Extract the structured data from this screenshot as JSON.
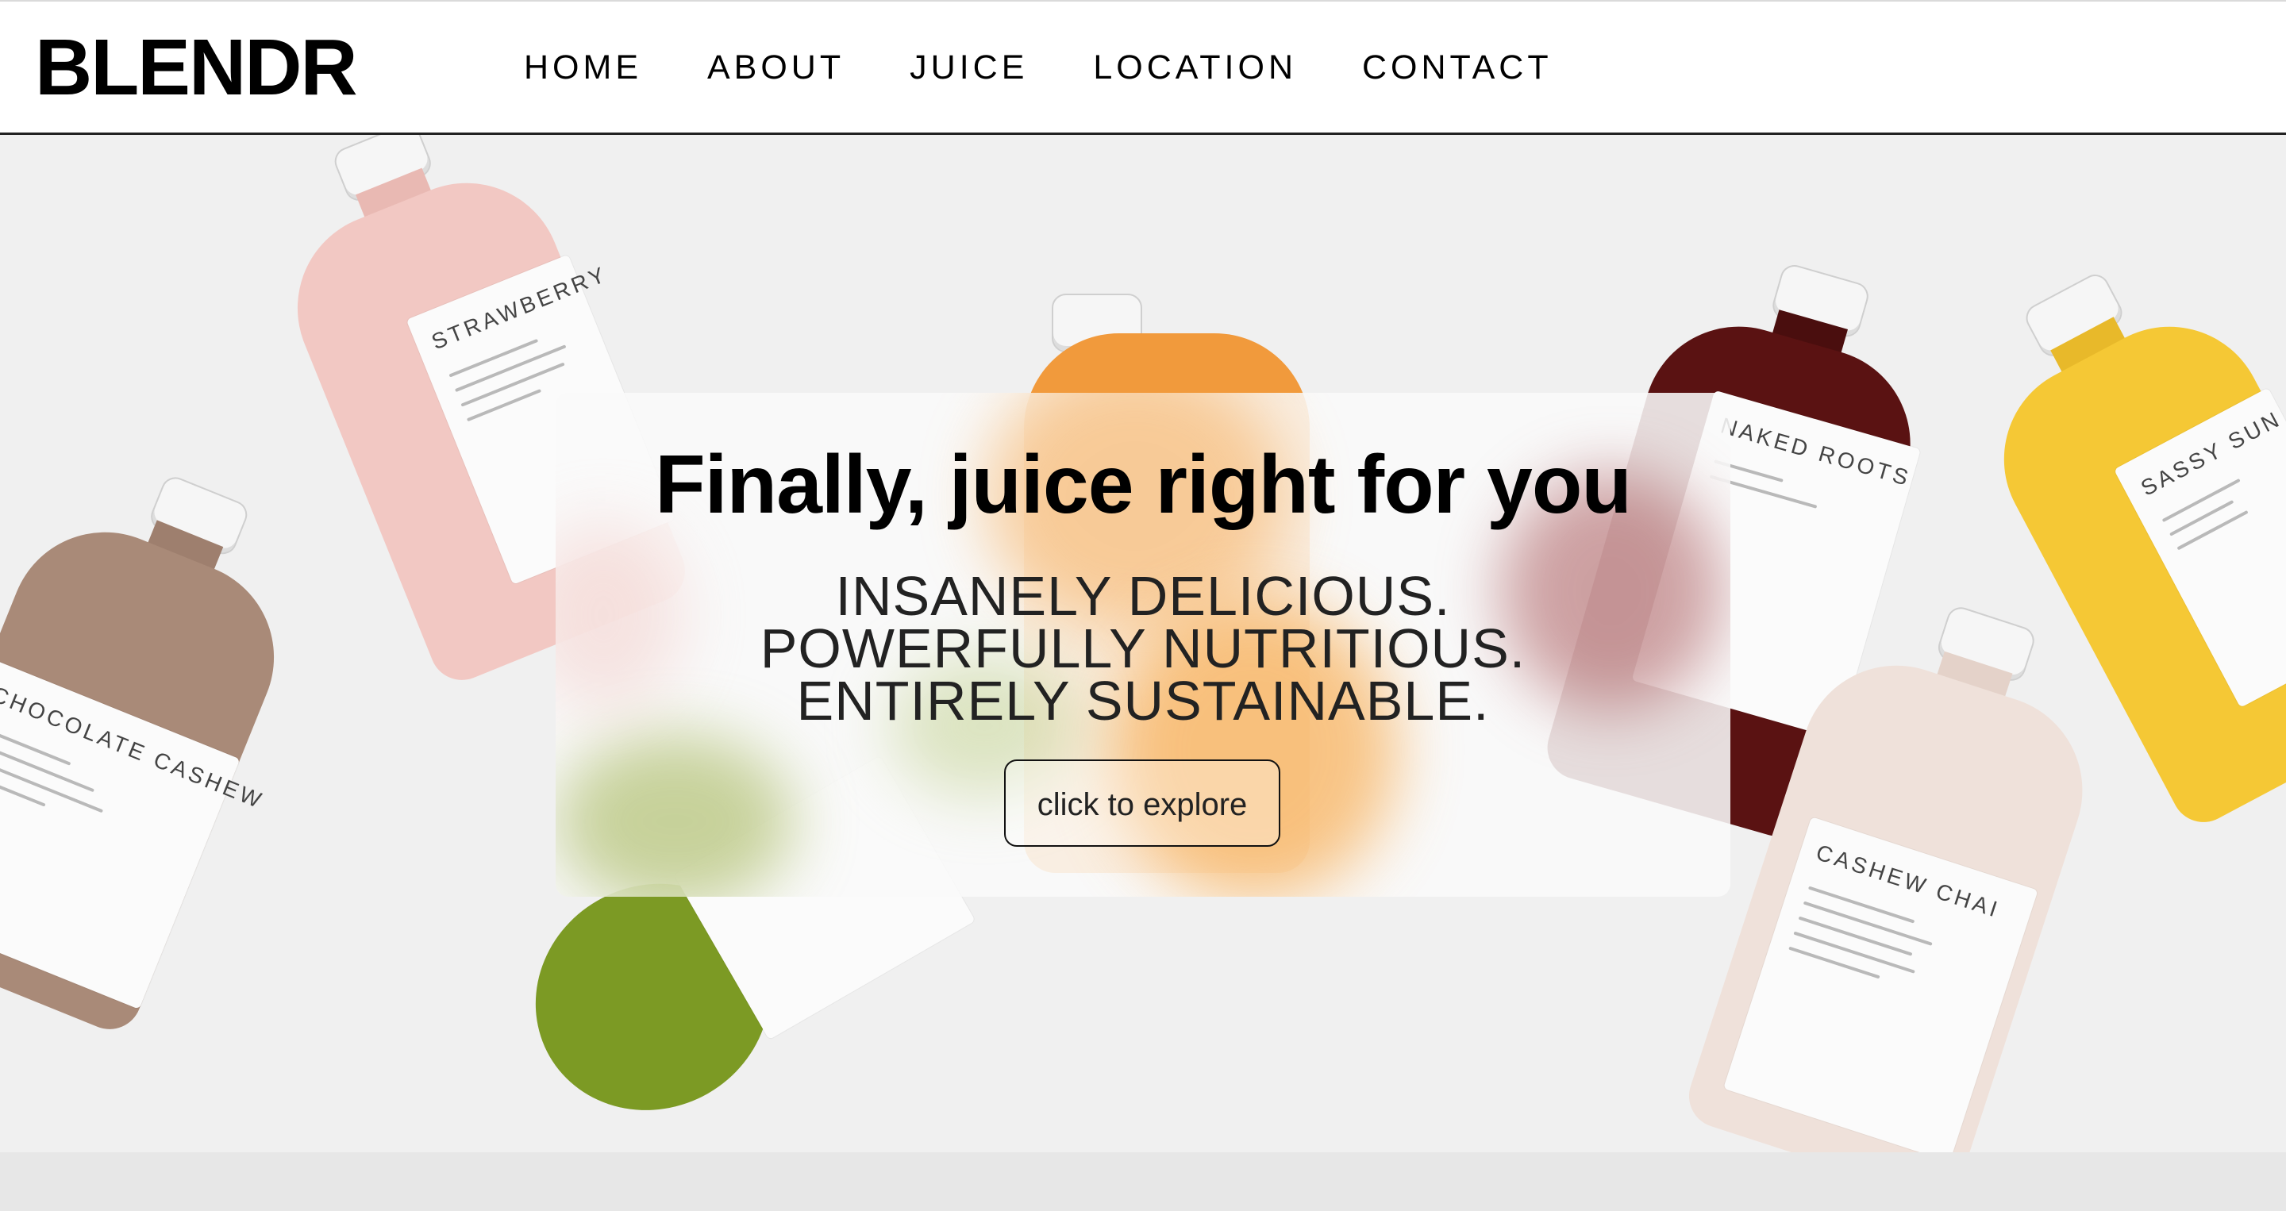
{
  "nav": {
    "logo": "BLENDR",
    "links": [
      "HOME",
      "ABOUT",
      "JUICE",
      "LOCATION",
      "CONTACT"
    ]
  },
  "hero": {
    "title": "Finally, juice right for you",
    "taglines": [
      "INSANELY DELICIOUS.",
      "POWERFULLY NUTRITIOUS.",
      "ENTIRELY SUSTAINABLE."
    ],
    "cta_label": "click to explore"
  },
  "bottles": {
    "chocolate": "CHOCOLATE CASHEW",
    "strawberry": "STRAWBERRY",
    "naked": "NAKED ROOTS",
    "sassy": "SASSY SUN",
    "chai": "CASHEW CHAI"
  },
  "colors": {
    "chocolate": "#a98a78",
    "strawberry": "#f2c8c3",
    "orange": "#f19a3c",
    "naked": "#5a1212",
    "sassy": "#f5c835",
    "chai": "#efe1da",
    "green": "#7c9a24"
  }
}
